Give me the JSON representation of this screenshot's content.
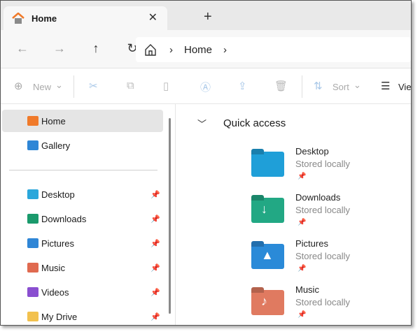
{
  "tab": {
    "title": "Home",
    "close": "✕",
    "new_tab": "+"
  },
  "nav": {
    "back": "←",
    "forward": "→",
    "up": "↑",
    "refresh": "↻",
    "breadcrumb": [
      "Home"
    ],
    "sep": "›"
  },
  "toolbar": {
    "new": "New",
    "sort": "Sort",
    "view": "View",
    "caret": "⌄"
  },
  "sidebar": {
    "items": [
      {
        "label": "Home",
        "color": "#f07a2a"
      },
      {
        "label": "Gallery",
        "color": "#2f86d6"
      },
      {
        "label": "Desktop",
        "color": "#2aa7db",
        "pinned": true
      },
      {
        "label": "Downloads",
        "color": "#1a9a6c",
        "pinned": true
      },
      {
        "label": "Pictures",
        "color": "#2f86d6",
        "pinned": true
      },
      {
        "label": "Music",
        "color": "#e06a50",
        "pinned": true
      },
      {
        "label": "Videos",
        "color": "#8a4fd0",
        "pinned": true
      },
      {
        "label": "My Drive",
        "color": "#f2c14e",
        "pinned": true
      }
    ]
  },
  "main": {
    "section": "Quick access",
    "items": [
      {
        "name": "Desktop",
        "status": "Stored locally",
        "color": "#1f9fd8"
      },
      {
        "name": "Downloads",
        "status": "Stored locally",
        "color": "#22a884"
      },
      {
        "name": "Pictures",
        "status": "Stored locally",
        "color": "#2a8ad8"
      },
      {
        "name": "Music",
        "status": "Stored locally",
        "color": "#e07a60"
      }
    ]
  }
}
